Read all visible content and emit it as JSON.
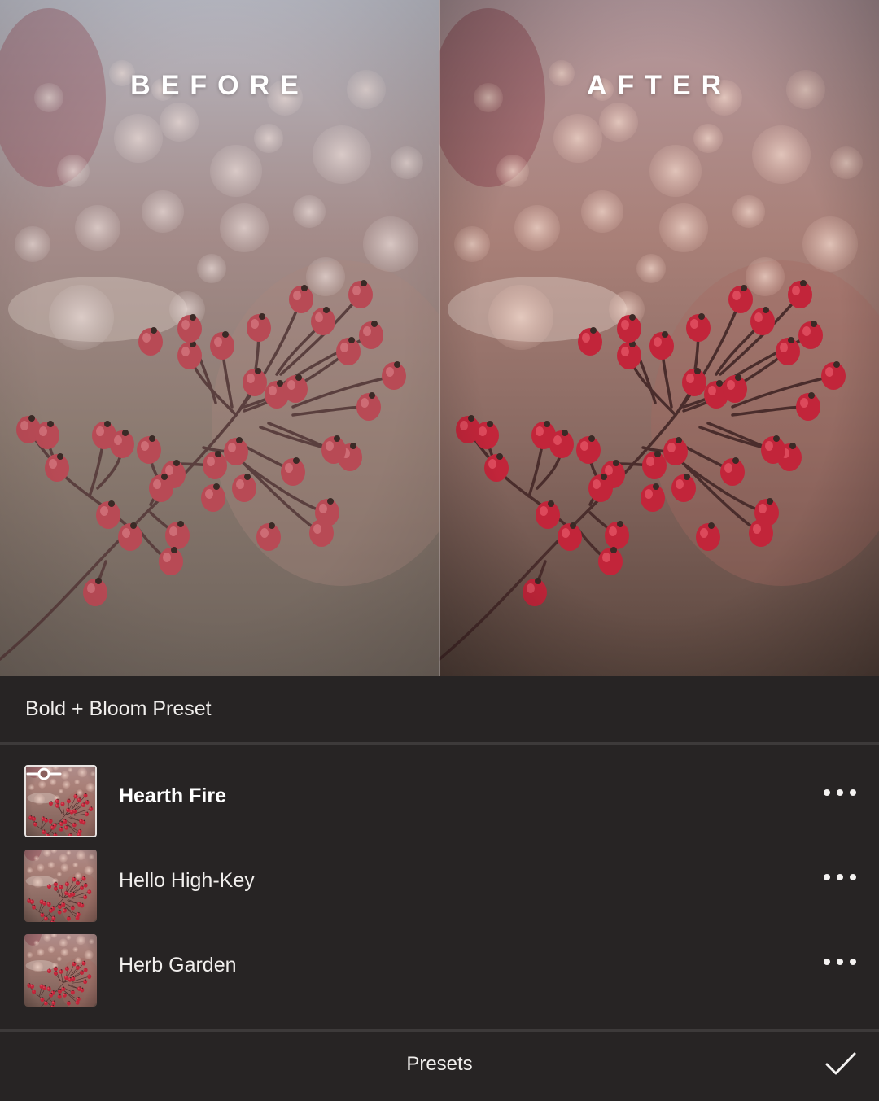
{
  "comparison": {
    "before_label": "BEFORE",
    "after_label": "AFTER"
  },
  "preset_group": {
    "title": "Bold + Bloom Preset"
  },
  "presets": [
    {
      "name": "Hearth Fire",
      "selected": true
    },
    {
      "name": "Hello High-Key",
      "selected": false
    },
    {
      "name": "Herb Garden",
      "selected": false
    }
  ],
  "bottom_bar": {
    "title": "Presets"
  },
  "colors": {
    "panel_background": "#272424",
    "separator": "#3d3a3a",
    "text": "#f0eeec",
    "berry_red": "#c2253a"
  },
  "icons": {
    "more": "more-horizontal-icon",
    "confirm": "checkmark-icon",
    "adjust": "slider-icon"
  }
}
